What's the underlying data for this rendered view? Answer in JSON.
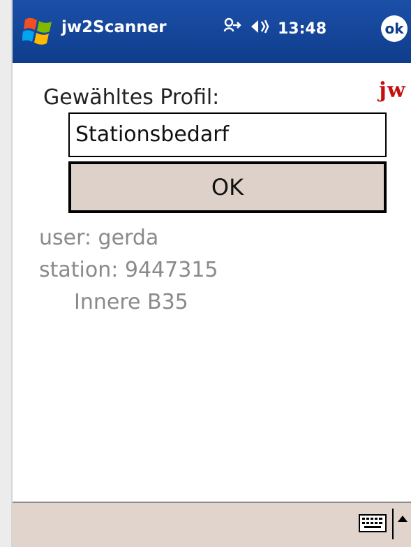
{
  "window": {
    "app_title": "jw2Scanner",
    "clock": "13:48",
    "ok_label": "ok"
  },
  "icons": {
    "start": "windows-flag-icon",
    "connectivity": "connectivity-icon",
    "volume": "volume-icon",
    "keyboard": "keyboard-icon",
    "sip_arrow": "up-arrow-icon"
  },
  "main": {
    "logo_text": "jw",
    "profile_label": "Gewähltes Profil:",
    "profile_value": "Stationsbedarf",
    "ok_button": "OK",
    "user_line": "user: gerda",
    "station_line": "station: 9447315",
    "station_sub": "Innere B35"
  },
  "colors": {
    "titlebar": "#0f3d8c",
    "logo": "#c41010",
    "info_text": "#8a8a8a",
    "button_bg": "#ddd1c9"
  }
}
